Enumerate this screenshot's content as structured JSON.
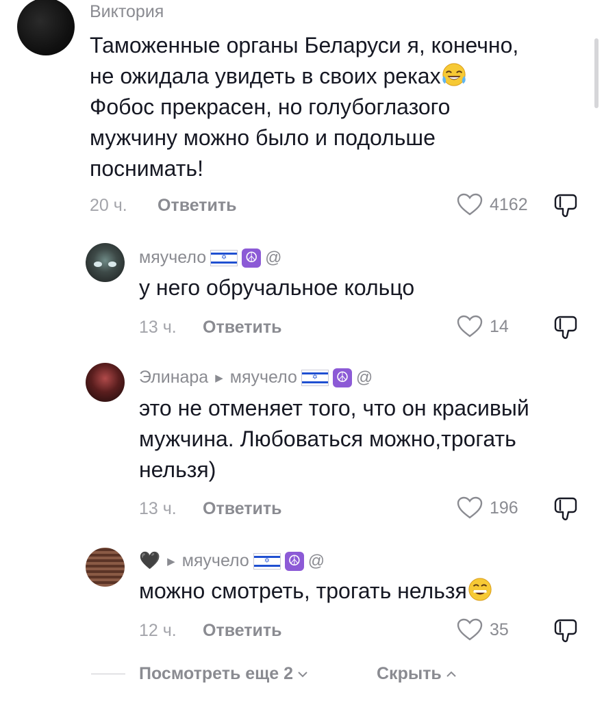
{
  "comments": [
    {
      "username": "Виктория",
      "text_lines": [
        "Таможенные органы Беларуси я, конечно,",
        "не ожидала увидеть в своих реках",
        "Фобос прекрасен, но голубоглазого",
        "мужчину можно было и подольше",
        "поснимать!"
      ],
      "time": "20 ч.",
      "reply_label": "Ответить",
      "likes": "4162",
      "emoji_after_line_2": "laughing-tears-emoji"
    },
    {
      "username": "мяучело",
      "at": "@",
      "text": "у него обручальное кольцо",
      "time": "13 ч.",
      "reply_label": "Ответить",
      "likes": "14"
    },
    {
      "username": "Элинара",
      "reply_to": "мяучело",
      "at": "@",
      "text_lines": [
        "это не отменяет того, что он красивый",
        "мужчина. Любоваться можно,трогать",
        "нельзя)"
      ],
      "time": "13 ч.",
      "reply_label": "Ответить",
      "likes": "196"
    },
    {
      "username_emoji": "🖤",
      "reply_to": "мяучело",
      "at": "@",
      "text": "можно смотреть, трогать нельзя",
      "time": "12 ч.",
      "reply_label": "Ответить",
      "likes": "35",
      "emoji_after_text": "grinning-emoji"
    }
  ],
  "footer": {
    "view_more": "Посмотреть еще 2",
    "hide": "Скрыть"
  },
  "icons": {
    "like": "heart-outline-icon",
    "dislike": "thumbs-down-icon",
    "peace": "☮",
    "flag_star": "✡"
  }
}
